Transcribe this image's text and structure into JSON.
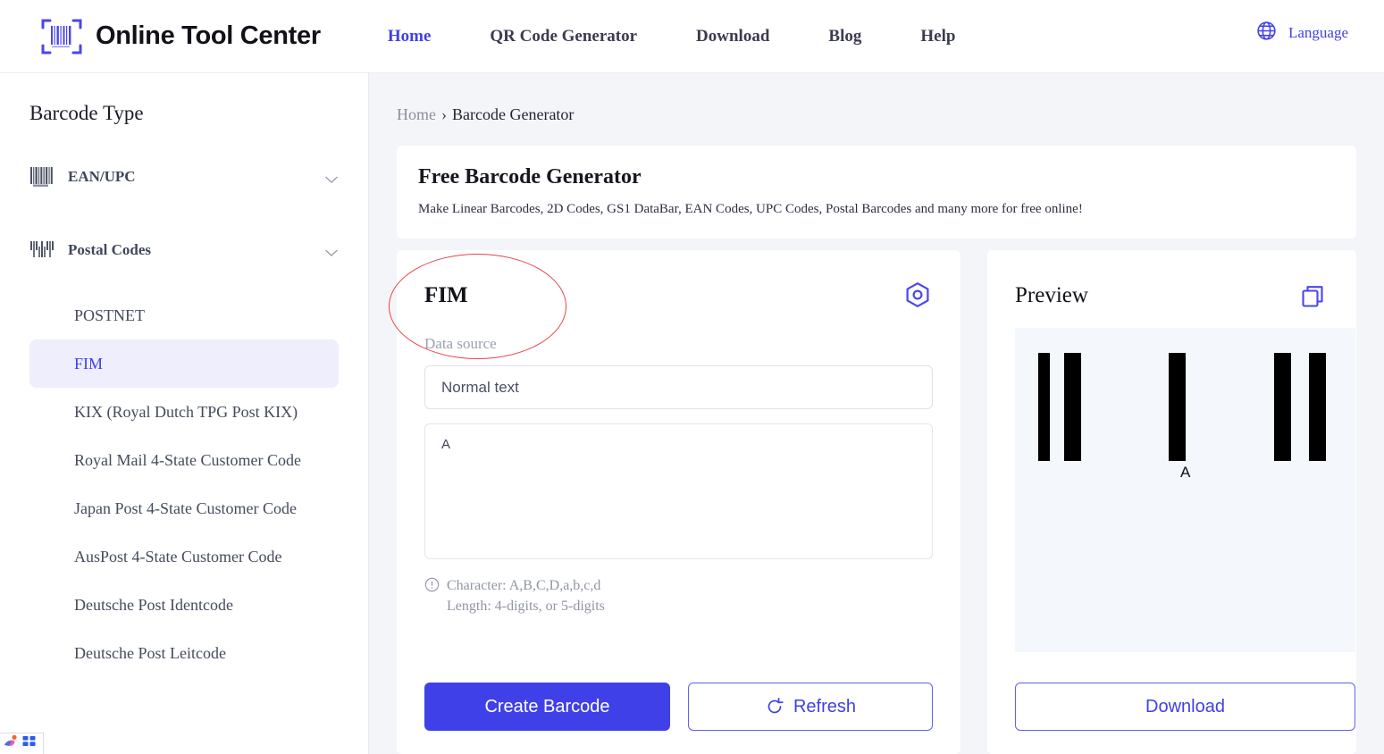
{
  "header": {
    "brand_name": "Online Tool Center",
    "logo_icon": "barcode-scan-icon",
    "nav": [
      {
        "label": "Home",
        "active": true
      },
      {
        "label": "QR Code Generator",
        "active": false
      },
      {
        "label": "Download",
        "active": false
      },
      {
        "label": "Blog",
        "active": false
      },
      {
        "label": "Help",
        "active": false
      }
    ],
    "language": {
      "label": "Language",
      "icon": "globe-icon"
    }
  },
  "sidebar": {
    "title": "Barcode Type",
    "groups": [
      {
        "label": "EAN/UPC",
        "icon": "barcode-icon",
        "chevron": "chevron-down-icon"
      },
      {
        "label": "Postal Codes",
        "icon": "postal-barcode-icon",
        "chevron": "chevron-down-icon"
      }
    ],
    "items": [
      {
        "label": "POSTNET",
        "active": false
      },
      {
        "label": "FIM",
        "active": true
      },
      {
        "label": "KIX (Royal Dutch TPG Post KIX)",
        "active": false
      },
      {
        "label": "Royal Mail 4-State Customer Code",
        "active": false
      },
      {
        "label": "Japan Post 4-State Customer Code",
        "active": false
      },
      {
        "label": "AusPost 4-State Customer Code",
        "active": false
      },
      {
        "label": "Deutsche Post Identcode",
        "active": false
      },
      {
        "label": "Deutsche Post Leitcode",
        "active": false
      }
    ]
  },
  "breadcrumb": {
    "home": "Home",
    "separator": "›",
    "current": "Barcode Generator"
  },
  "banner": {
    "title": "Free Barcode Generator",
    "subtitle": "Make Linear Barcodes, 2D Codes, GS1 DataBar, EAN Codes, UPC Codes, Postal Barcodes and many more for free online!"
  },
  "generator": {
    "title": "FIM",
    "settings_icon": "settings-hexagon-icon",
    "data_source_label": "Data source",
    "data_source_value": "Normal text",
    "data_input_value": "A",
    "hint_icon": "info-circle-icon",
    "hint_line1": "Character: A,B,C,D,a,b,c,d",
    "hint_line2": "Length: 4-digits, or 5-digits",
    "create_label": "Create Barcode",
    "refresh_label": "Refresh",
    "refresh_icon": "refresh-icon"
  },
  "preview": {
    "title": "Preview",
    "copy_icon": "copy-icon",
    "barcode_label": "A",
    "download_label": "Download"
  },
  "colors": {
    "accent_blue": "#4040e8",
    "active_item_bg": "#eeeefc",
    "page_bg": "#f4f5f9",
    "preview_bg": "#f4f7fc",
    "annotation_red": "#e8424c"
  }
}
